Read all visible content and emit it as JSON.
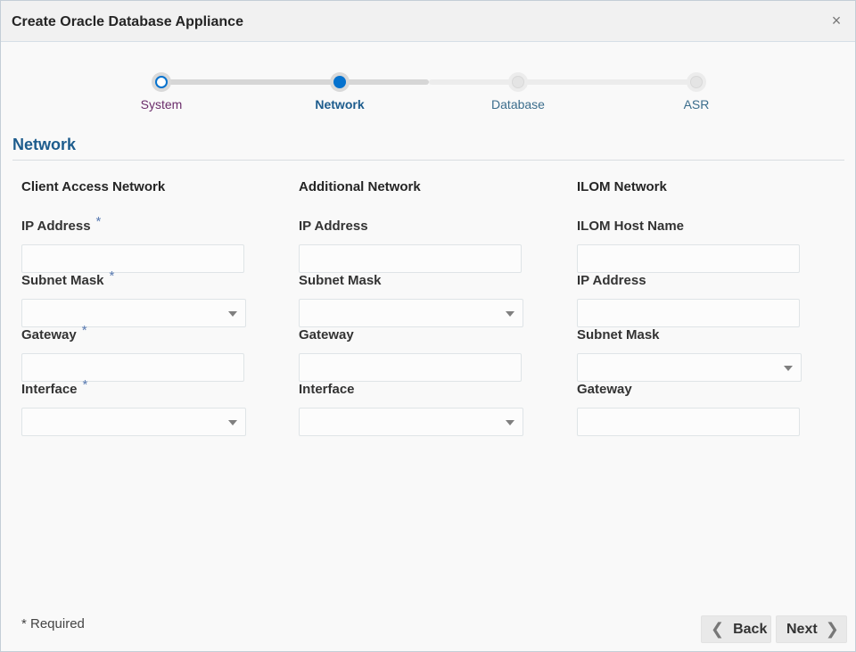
{
  "dialog": {
    "title": "Create Oracle Database Appliance",
    "close_glyph": "×"
  },
  "train": {
    "steps": [
      {
        "label": "System",
        "state": "visited"
      },
      {
        "label": "Network",
        "state": "current"
      },
      {
        "label": "Database",
        "state": "future"
      },
      {
        "label": "ASR",
        "state": "future"
      }
    ]
  },
  "section": {
    "title": "Network"
  },
  "client_access": {
    "heading": "Client Access Network",
    "ip_label": "IP Address",
    "ip_value": "",
    "subnet_label": "Subnet Mask",
    "subnet_value": "",
    "gateway_label": "Gateway",
    "gateway_value": "",
    "interface_label": "Interface",
    "interface_value": ""
  },
  "additional": {
    "heading": "Additional Network",
    "ip_label": "IP Address",
    "ip_value": "",
    "subnet_label": "Subnet Mask",
    "subnet_value": "",
    "gateway_label": "Gateway",
    "gateway_value": "",
    "interface_label": "Interface",
    "interface_value": ""
  },
  "ilom": {
    "heading": "ILOM Network",
    "host_label": "ILOM Host Name",
    "host_value": "",
    "ip_label": "IP Address",
    "ip_value": "",
    "subnet_label": "Subnet Mask",
    "subnet_value": "",
    "gateway_label": "Gateway",
    "gateway_value": ""
  },
  "required_marker": "*",
  "footer": {
    "required_note": "* Required",
    "back_label": "Back",
    "next_label": "Next",
    "back_glyph": "❮",
    "next_glyph": "❯"
  },
  "colors": {
    "accent": "#0572ce",
    "heading": "#1d5c8d"
  }
}
